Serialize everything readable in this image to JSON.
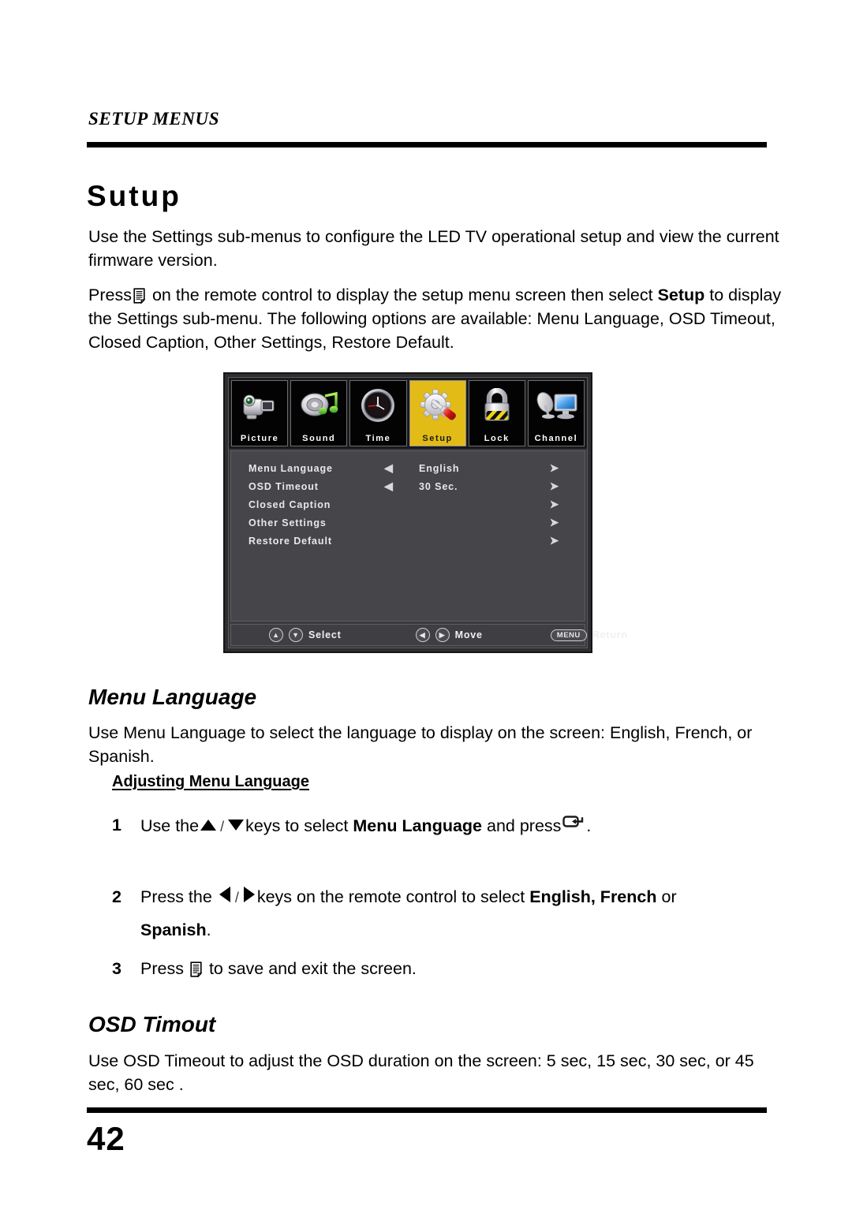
{
  "header": {
    "running_head": "SETUP MENUS"
  },
  "heading": {
    "h1": "Sutup"
  },
  "intro": {
    "paragraph_1": "Use the Settings sub-menus to configure the LED TV operational setup and view the current firmware version.",
    "paragraph_2_part_1": "Press",
    "paragraph_2_part_2": "on the remote control to display the setup menu screen then select",
    "paragraph_2_bold": "Setup",
    "paragraph_2_part_3": "to display the Settings sub-menu. The following options are available: Menu Language, OSD Timeout, Closed Caption, Other Settings, Restore Default."
  },
  "osd": {
    "tabs": [
      {
        "label": "Picture",
        "icon": "camcorder-icon",
        "active": false
      },
      {
        "label": "Sound",
        "icon": "speaker-music-note-icon",
        "active": false
      },
      {
        "label": "Time",
        "icon": "clock-icon",
        "active": false
      },
      {
        "label": "Setup",
        "icon": "gear-screwdriver-icon",
        "active": true
      },
      {
        "label": "Lock",
        "icon": "padlock-icon",
        "active": false
      },
      {
        "label": "Channel",
        "icon": "satellite-dish-monitor-icon",
        "active": false
      }
    ],
    "rows": [
      {
        "label": "Menu Language",
        "left_arrow": "◀",
        "value": "English",
        "right_arrow": "➤"
      },
      {
        "label": "OSD Timeout",
        "left_arrow": "◀",
        "value": "30 Sec.",
        "right_arrow": "➤"
      },
      {
        "label": "Closed Caption",
        "left_arrow": "",
        "value": "",
        "right_arrow": "➤"
      },
      {
        "label": "Other Settings",
        "left_arrow": "",
        "value": "",
        "right_arrow": "➤"
      },
      {
        "label": "Restore Default",
        "left_arrow": "",
        "value": "",
        "right_arrow": "➤"
      }
    ],
    "footer": {
      "select_key_up": "▲",
      "select_key_down": "▼",
      "select_label": "Select",
      "move_key_left": "◀",
      "move_key_right": "▶",
      "move_label": "Move",
      "return_key": "MENU",
      "return_label": "Return"
    },
    "colors": {
      "active_tab": "#e3bb16",
      "panel_body": "#46464a",
      "tile_background": "#030303",
      "frame": "#2e2e30"
    }
  },
  "menu_language": {
    "heading": "Menu Language",
    "description": "Use Menu Language to select the language to display on the screen: English, French, or Spanish.",
    "subheading": "Adjusting Menu Language",
    "steps": {
      "step1": {
        "number": "1",
        "text_before": "Use the",
        "separator": "/",
        "text_middle": "keys to select",
        "bold_term": "Menu Language",
        "text_after": "and press",
        "text_end": ".",
        "icon_up": "up-triangle-icon",
        "icon_down": "down-triangle-icon",
        "icon_enter": "enter-key-icon"
      },
      "step2": {
        "number": "2",
        "text_before": "Press the",
        "separator": "/",
        "text_middle": "keys on the remote control to select",
        "bold_term": "English, French",
        "text_after": "or",
        "icon_left": "left-triangle-icon",
        "icon_right": "right-triangle-icon"
      },
      "step2_continued": {
        "bold_term": "Spanish",
        "text_after": "."
      },
      "step3": {
        "number": "3",
        "text_before": "Press",
        "text_after": "to save and exit the screen.",
        "icon_menu": "menu-document-icon"
      }
    }
  },
  "osd_timout": {
    "heading": "OSD Timout",
    "description": "Use OSD Timeout to adjust the OSD duration on the screen: 5 sec, 15 sec, 30 sec, or 45 sec, 60 sec ."
  },
  "footer": {
    "page_number": "42"
  }
}
